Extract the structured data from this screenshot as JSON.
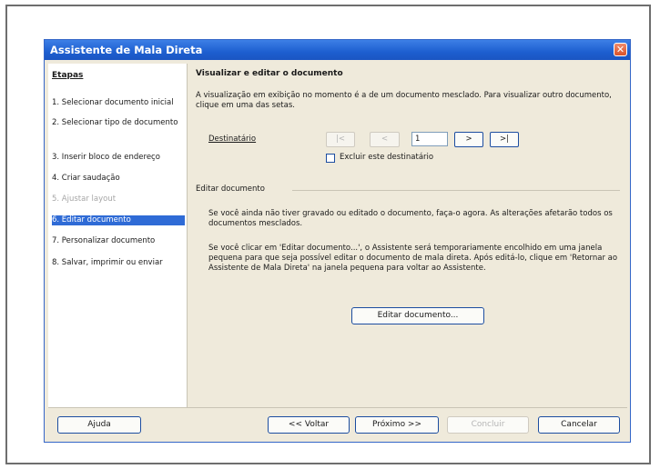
{
  "window": {
    "title": "Assistente de Mala Direta"
  },
  "steps": {
    "heading": "Etapas",
    "items": [
      {
        "label": "1. Selecionar documento inicial"
      },
      {
        "label": "2. Selecionar tipo de documento"
      },
      {
        "label": "3. Inserir bloco de endereço"
      },
      {
        "label": "4. Criar saudação"
      },
      {
        "label": "5. Ajustar layout",
        "state": "disabled"
      },
      {
        "label": "6. Editar documento",
        "state": "selected"
      },
      {
        "label": "7. Personalizar documento"
      },
      {
        "label": "8. Salvar, imprimir ou enviar"
      }
    ]
  },
  "content": {
    "title": "Visualizar e editar o documento",
    "intro": "A visualização em exibição no momento é a de um documento mesclado. Para visualizar outro documento, clique em uma das setas.",
    "recipient_label": "Destinatário",
    "nav": {
      "first": "|<",
      "prev": "<",
      "next": ">",
      "last": ">|"
    },
    "record_value": "1",
    "exclude_label": "Excluir este destinatário",
    "edit_heading": "Editar documento",
    "paragraph1": "Se você ainda não tiver gravado ou editado o documento, faça-o agora. As alterações afetarão todos os documentos mesclados.",
    "paragraph2": "Se você clicar em 'Editar documento...', o Assistente será temporariamente encolhido em uma janela pequena para que seja possível editar o documento de mala direta. Após editá-lo, clique em 'Retornar ao Assistente de Mala Direta' na janela pequena para voltar ao Assistente.",
    "edit_button": "Editar documento..."
  },
  "footer": {
    "help": "Ajuda",
    "back": "<< Voltar",
    "next": "Próximo >>",
    "finish": "Concluir",
    "cancel": "Cancelar"
  },
  "colors": {
    "titlebar": "#1d5fd0",
    "selected_step": "#2f6bd6",
    "dialog_bg": "#efeadb",
    "close_button": "#d9532b"
  }
}
